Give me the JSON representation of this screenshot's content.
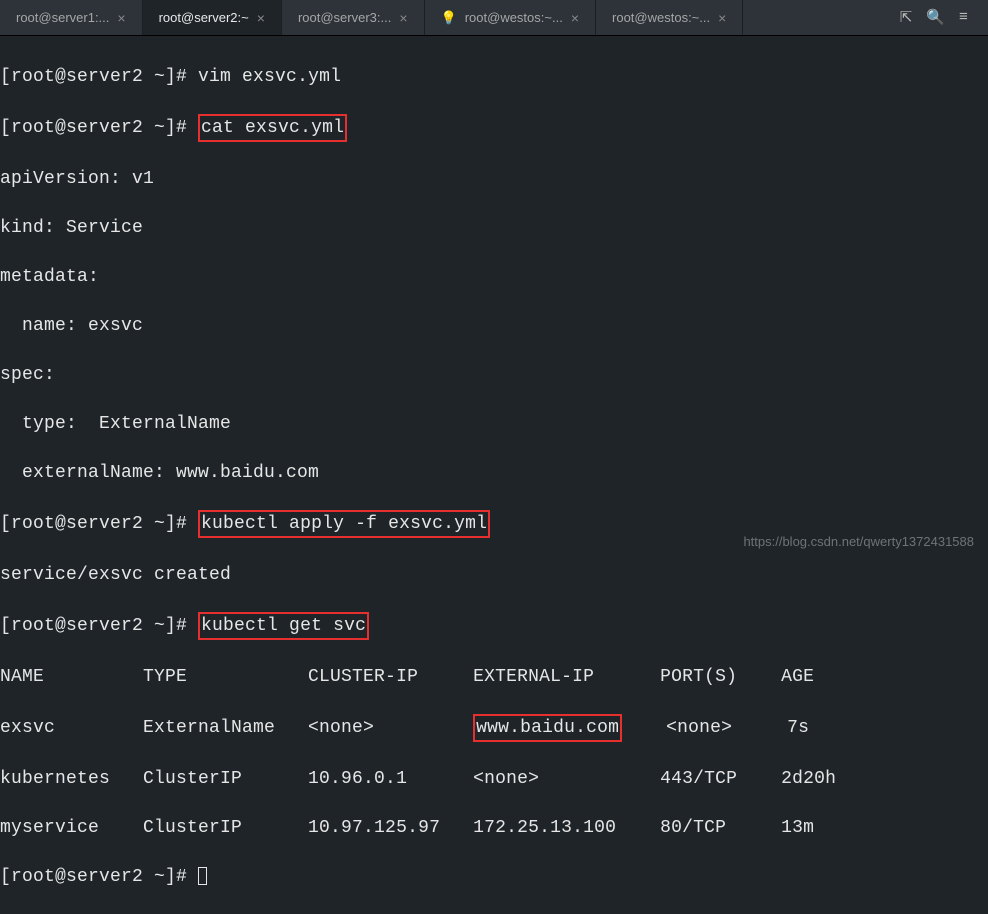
{
  "tabs": [
    {
      "label": "root@server1:...",
      "active": false,
      "bulb": false
    },
    {
      "label": "root@server2:~",
      "active": true,
      "bulb": false
    },
    {
      "label": "root@server3:...",
      "active": false,
      "bulb": false
    },
    {
      "label": "root@westos:~...",
      "active": false,
      "bulb": true
    },
    {
      "label": "root@westos:~...",
      "active": false,
      "bulb": false
    }
  ],
  "prompt": "[root@server2 ~]# ",
  "cmd1": "vim exsvc.yml",
  "cmd2": "cat exsvc.yml",
  "yaml": {
    "l1": "apiVersion: v1",
    "l2": "kind: Service",
    "l3": "metadata:",
    "l4": "  name: exsvc",
    "l5": "spec:",
    "l6": "  type:  ExternalName",
    "l7": "  externalName: www.baidu.com"
  },
  "cmd3": "kubectl apply -f exsvc.yml",
  "out3": "service/exsvc created",
  "cmd4": "kubectl get svc",
  "table": {
    "header": {
      "c1": "NAME",
      "c2": "TYPE",
      "c3": "CLUSTER-IP",
      "c4": "EXTERNAL-IP",
      "c5": "PORT(S)",
      "c6": "AGE"
    },
    "rows": [
      {
        "c1": "exsvc",
        "c2": "ExternalName",
        "c3": "<none>",
        "c4": "www.baidu.com",
        "c5": "<none>",
        "c6": "7s",
        "hl4": true
      },
      {
        "c1": "kubernetes",
        "c2": "ClusterIP",
        "c3": "10.96.0.1",
        "c4": "<none>",
        "c5": "443/TCP",
        "c6": "2d20h"
      },
      {
        "c1": "myservice",
        "c2": "ClusterIP",
        "c3": "10.97.125.97",
        "c4": "172.25.13.100",
        "c5": "80/TCP",
        "c6": "13m"
      }
    ]
  },
  "watermark": "https://blog.csdn.net/qwerty1372431588",
  "icons": {
    "download": "⇱",
    "search": "🔍",
    "menu": "≡"
  }
}
